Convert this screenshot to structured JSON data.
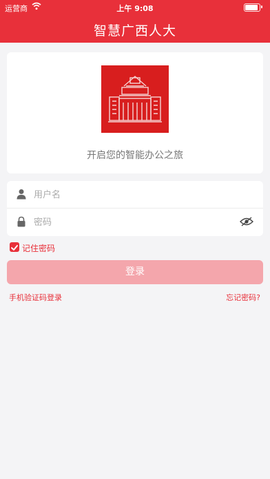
{
  "status_bar": {
    "carrier": "运营商",
    "time": "上午 9:08",
    "battery_level": 0.9
  },
  "header": {
    "title": "智慧广西人大"
  },
  "hero": {
    "slogan": "开启您的智能办公之旅"
  },
  "form": {
    "username_placeholder": "用户名",
    "password_placeholder": "密码",
    "remember_label": "记住密码",
    "remember_checked": true,
    "login_label": "登录",
    "sms_login_label": "手机验证码登录",
    "forgot_label": "忘记密码?"
  },
  "colors": {
    "brand_red": "#e8303a",
    "button_disabled": "#f4a6ac",
    "logo_red": "#d81e1e",
    "background": "#f4f4f6"
  },
  "icons": {
    "username": "user-icon",
    "password": "lock-icon",
    "visibility": "eye-hidden-icon",
    "checkbox": "checkbox-checked-icon",
    "logo": "building-logo"
  }
}
